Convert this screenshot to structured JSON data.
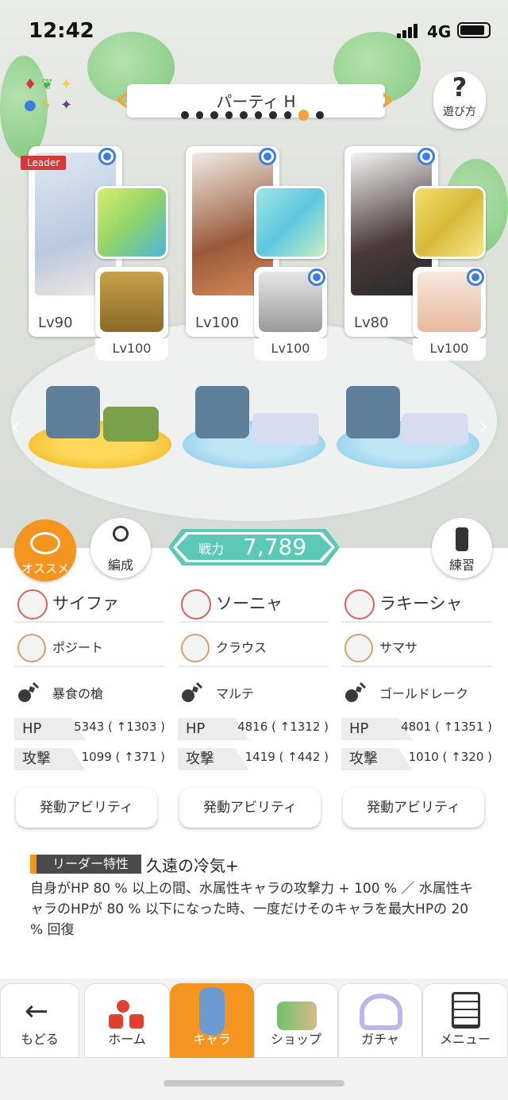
{
  "status_bar": {
    "time": "12:42",
    "network": "4G"
  },
  "party": {
    "title": "パーティ H",
    "page_count": 10,
    "active_index": 8
  },
  "help": {
    "label": "遊び方"
  },
  "leader_badge": "Leader",
  "cards": [
    {
      "lv": "Lv90",
      "sub_lv": "Lv100"
    },
    {
      "lv": "Lv100",
      "sub_lv": "Lv100"
    },
    {
      "lv": "Lv80",
      "sub_lv": "Lv100"
    }
  ],
  "buttons": {
    "recommend": "オススメ",
    "formation": "編成",
    "practice": "練習"
  },
  "power": {
    "label": "戦力",
    "value": "7,789"
  },
  "members": [
    {
      "name": "サイファ",
      "sub": "ポジート",
      "weapon": "暴食の槍",
      "hp_label": "HP",
      "hp": "5343 ( ↑1303 )",
      "atk_label": "攻撃",
      "atk": "1099 ( ↑371 )",
      "ability": "発動アビリティ"
    },
    {
      "name": "ソーニャ",
      "sub": "クラウス",
      "weapon": "マルテ",
      "hp_label": "HP",
      "hp": "4816 ( ↑1312 )",
      "atk_label": "攻撃",
      "atk": "1419 ( ↑442 )",
      "ability": "発動アビリティ"
    },
    {
      "name": "ラキーシャ",
      "sub": "サマサ",
      "weapon": "ゴールドレーク",
      "hp_label": "HP",
      "hp": "4801 ( ↑1351 )",
      "atk_label": "攻撃",
      "atk": "1010 ( ↑320 )",
      "ability": "発動アビリティ"
    }
  ],
  "leader_skill": {
    "tag": "リーダー特性",
    "name": "久遠の冷気+",
    "desc": "自身がHP 80 % 以上の間、水属性キャラの攻撃力 + 100 % ／ 水属性キャラのHPが 80 % 以下になった時、一度だけそのキャラを最大HPの 20 % 回復"
  },
  "nav": {
    "back": "もどる",
    "home": "ホーム",
    "chara": "キャラ",
    "shop": "ショップ",
    "gacha": "ガチャ",
    "menu": "メニュー"
  },
  "colors": {
    "accent": "#f4951f",
    "power": "#5cc8b6",
    "badge": "#3b7de0"
  }
}
